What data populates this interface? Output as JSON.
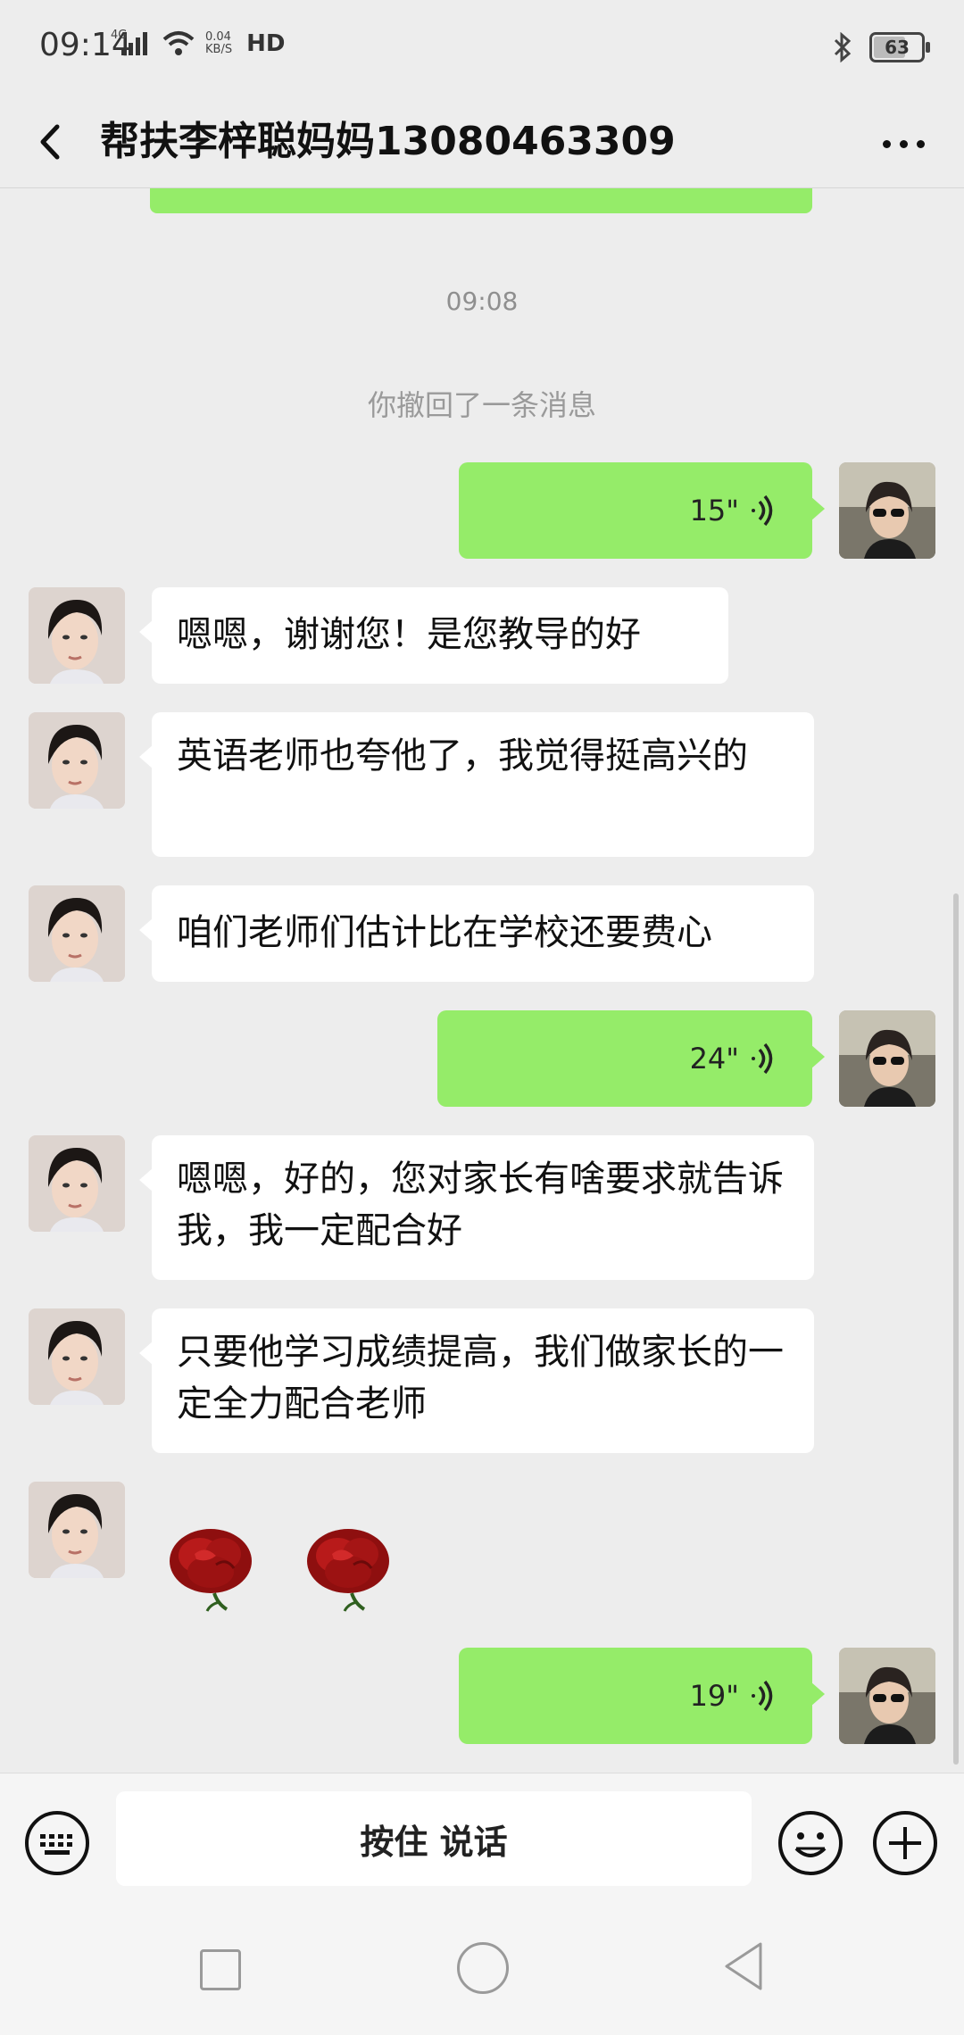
{
  "status_bar": {
    "time": "09:14",
    "network_type": "4G",
    "net_speed": "0.04",
    "net_unit": "KB/S",
    "hd_label": "HD",
    "battery_level": "63",
    "icons": [
      "signal-icon",
      "wifi-icon",
      "bluetooth-icon",
      "battery-icon"
    ]
  },
  "header": {
    "title": "帮扶李梓聪妈妈13080463309",
    "back_icon": "chevron-left-icon",
    "more_icon": "more-dots-icon"
  },
  "chat": {
    "timestamp": "09:08",
    "recall_notice": "你撤回了一条消息",
    "messages": [
      {
        "side": "right",
        "type": "voice",
        "duration": "15\""
      },
      {
        "side": "left",
        "type": "text",
        "text": "嗯嗯，谢谢您！是您教导的好"
      },
      {
        "side": "left",
        "type": "text",
        "text": "英语老师也夸他了，我觉得挺高兴的"
      },
      {
        "side": "left",
        "type": "text",
        "text": "咱们老师们估计比在学校还要费心"
      },
      {
        "side": "right",
        "type": "voice",
        "duration": "24\""
      },
      {
        "side": "left",
        "type": "text",
        "text": "嗯嗯，好的，您对家长有啥要求就告诉我，我一定配合好"
      },
      {
        "side": "left",
        "type": "text",
        "text": "只要他学习成绩提高，我们做家长的一定全力配合老师"
      },
      {
        "side": "left",
        "type": "sticker",
        "icons": [
          "rose-icon",
          "rose-icon"
        ]
      },
      {
        "side": "right",
        "type": "voice",
        "duration": "19\""
      }
    ]
  },
  "input_bar": {
    "hold_to_talk": "按住 说话",
    "keyboard_icon": "keyboard-icon",
    "emoji_icon": "emoji-icon",
    "plus_icon": "plus-icon"
  },
  "nav_bar": {
    "icons": [
      "recent-apps-icon",
      "home-icon",
      "back-icon"
    ]
  },
  "colors": {
    "background": "#ededed",
    "sent_bubble": "#95ec69",
    "received_bubble": "#ffffff"
  }
}
